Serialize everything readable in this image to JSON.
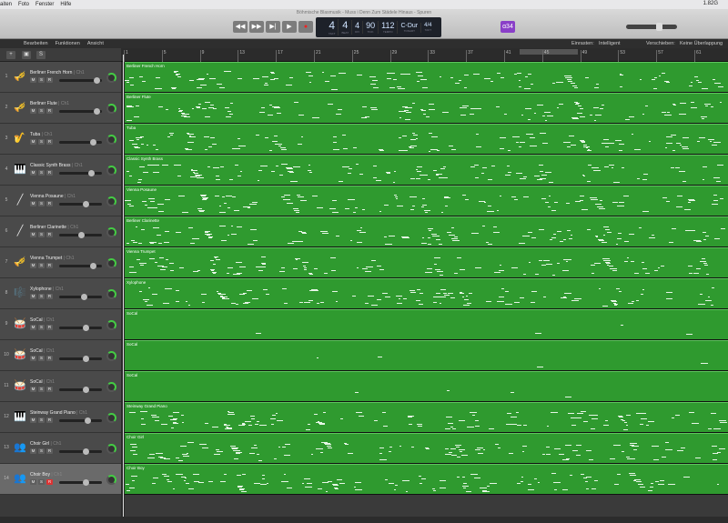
{
  "menubar": {
    "items": [
      "aiten",
      "Foto",
      "Fenster",
      "Hilfe"
    ],
    "memory": "1.82G"
  },
  "window": {
    "title": "Böhmische Blasmusik - Muss i Denn Zum Städele Hinaus - Spuren"
  },
  "transport": {
    "rewind": "◀◀",
    "forward": "▶▶",
    "to_start": "▶|",
    "play": "▶",
    "record": "●"
  },
  "lcd": {
    "bar": "4",
    "beat": "4",
    "div": "4",
    "tick": "90",
    "tempo": "112",
    "key": "C-Dur",
    "signature": "4/4",
    "labels": {
      "bar": "TAKT",
      "beat": "BEAT",
      "div": "DIV",
      "tick": "TICK",
      "tempo": "TEMPO",
      "key": "TONART",
      "sig": "TAKT"
    }
  },
  "lcd_mode": "ɑ34",
  "toolbar": {
    "edit": "Bearbeiten",
    "functions": "Funktionen",
    "view": "Ansicht",
    "snap_label": "Einrasten:",
    "snap_value": "Intelligent",
    "drag_label": "Verschieben:",
    "drag_value": "Keine Überlappung"
  },
  "header_buttons": {
    "add": "+",
    "s": "S"
  },
  "ruler": [
    "1",
    "5",
    "9",
    "13",
    "17",
    "21",
    "25",
    "29",
    "33",
    "37",
    "41",
    "45",
    "49",
    "53",
    "57",
    "61"
  ],
  "accent": "#2f9a2f",
  "tracks": [
    {
      "num": "1",
      "name": "Berliner French Horn",
      "ch": "Ch1",
      "icon": "🎺",
      "volume": 0.95
    },
    {
      "num": "2",
      "name": "Berliner Flute",
      "ch": "Ch1",
      "icon": "🎺",
      "volume": 0.95
    },
    {
      "num": "3",
      "name": "Tuba",
      "ch": "Ch1",
      "icon": "🎷",
      "volume": 0.85
    },
    {
      "num": "4",
      "name": "Classic Synth Brass",
      "ch": "Ch1",
      "icon": "🎹",
      "volume": 0.8
    },
    {
      "num": "5",
      "name": "Vienna Posaune",
      "ch": "Ch1",
      "icon": "╱",
      "volume": 0.65
    },
    {
      "num": "6",
      "name": "Berliner Clarinette",
      "ch": "Ch1",
      "icon": "╱",
      "volume": 0.52
    },
    {
      "num": "7",
      "name": "Vienna Trumpet",
      "ch": "Ch1",
      "icon": "🎺",
      "volume": 0.85
    },
    {
      "num": "8",
      "name": "Xylophone",
      "ch": "Ch1",
      "icon": "🎼",
      "volume": 0.6
    },
    {
      "num": "9",
      "name": "SoCal",
      "ch": "Ch1",
      "icon": "🥁",
      "volume": 0.65
    },
    {
      "num": "10",
      "name": "SoCal",
      "ch": "Ch1",
      "icon": "🥁",
      "volume": 0.65
    },
    {
      "num": "11",
      "name": "SoCal",
      "ch": "Ch1",
      "icon": "🥁",
      "volume": 0.65
    },
    {
      "num": "12",
      "name": "Steinway Grand Piano",
      "ch": "Ch1",
      "icon": "🎹",
      "volume": 0.7
    },
    {
      "num": "13",
      "name": "Choir Girl",
      "ch": "Ch1",
      "icon": "👥",
      "volume": 0.65
    },
    {
      "num": "14",
      "name": "Choir Boy",
      "ch": "Ch1",
      "icon": "👥",
      "volume": 0.65,
      "rec": true,
      "selected": true
    }
  ],
  "msr": {
    "m": "M",
    "s": "S",
    "r": "R"
  }
}
